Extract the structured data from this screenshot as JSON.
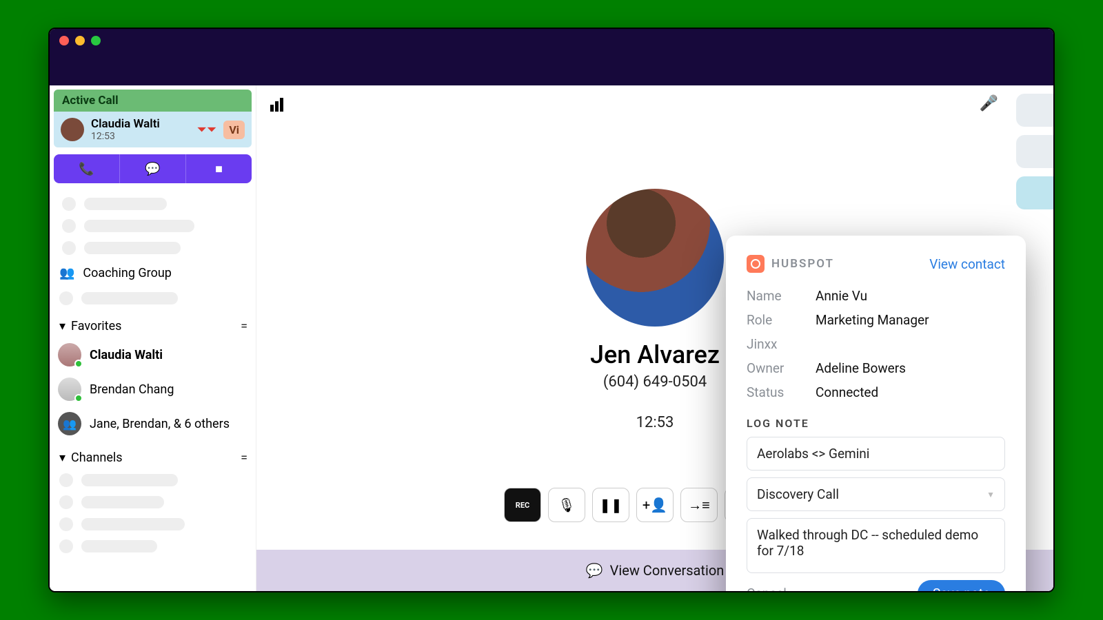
{
  "sidebar": {
    "active_call_label": "Active Call",
    "active_call": {
      "name": "Claudia Walti",
      "time": "12:53",
      "badge": "Vi"
    },
    "coaching_label": "Coaching Group",
    "favorites_label": "Favorites",
    "favorites": [
      {
        "name": "Claudia Walti",
        "bold": true
      },
      {
        "name": "Brendan Chang",
        "bold": false
      },
      {
        "name": "Jane, Brendan, & 6 others",
        "bold": false
      }
    ],
    "channels_label": "Channels"
  },
  "call": {
    "name": "Jen Alvarez",
    "phone": "(604) 649-0504",
    "time": "12:53",
    "view_conversation": "View Conversation"
  },
  "panel": {
    "brand": "HUBSPOT",
    "view_contact": "View contact",
    "fields": {
      "name_label": "Name",
      "name_value": "Annie Vu",
      "role_label": "Role",
      "role_value": "Marketing Manager",
      "company_label": "Jinxx",
      "owner_label": "Owner",
      "owner_value": "Adeline Bowers",
      "status_label": "Status",
      "status_value": "Connected"
    },
    "log_note_label": "LOG NOTE",
    "note_title": "Aerolabs <> Gemini",
    "note_type": "Discovery Call",
    "note_body": "Walked through DC -- scheduled demo for 7/18",
    "cancel": "Cancel",
    "save": "Save note"
  }
}
